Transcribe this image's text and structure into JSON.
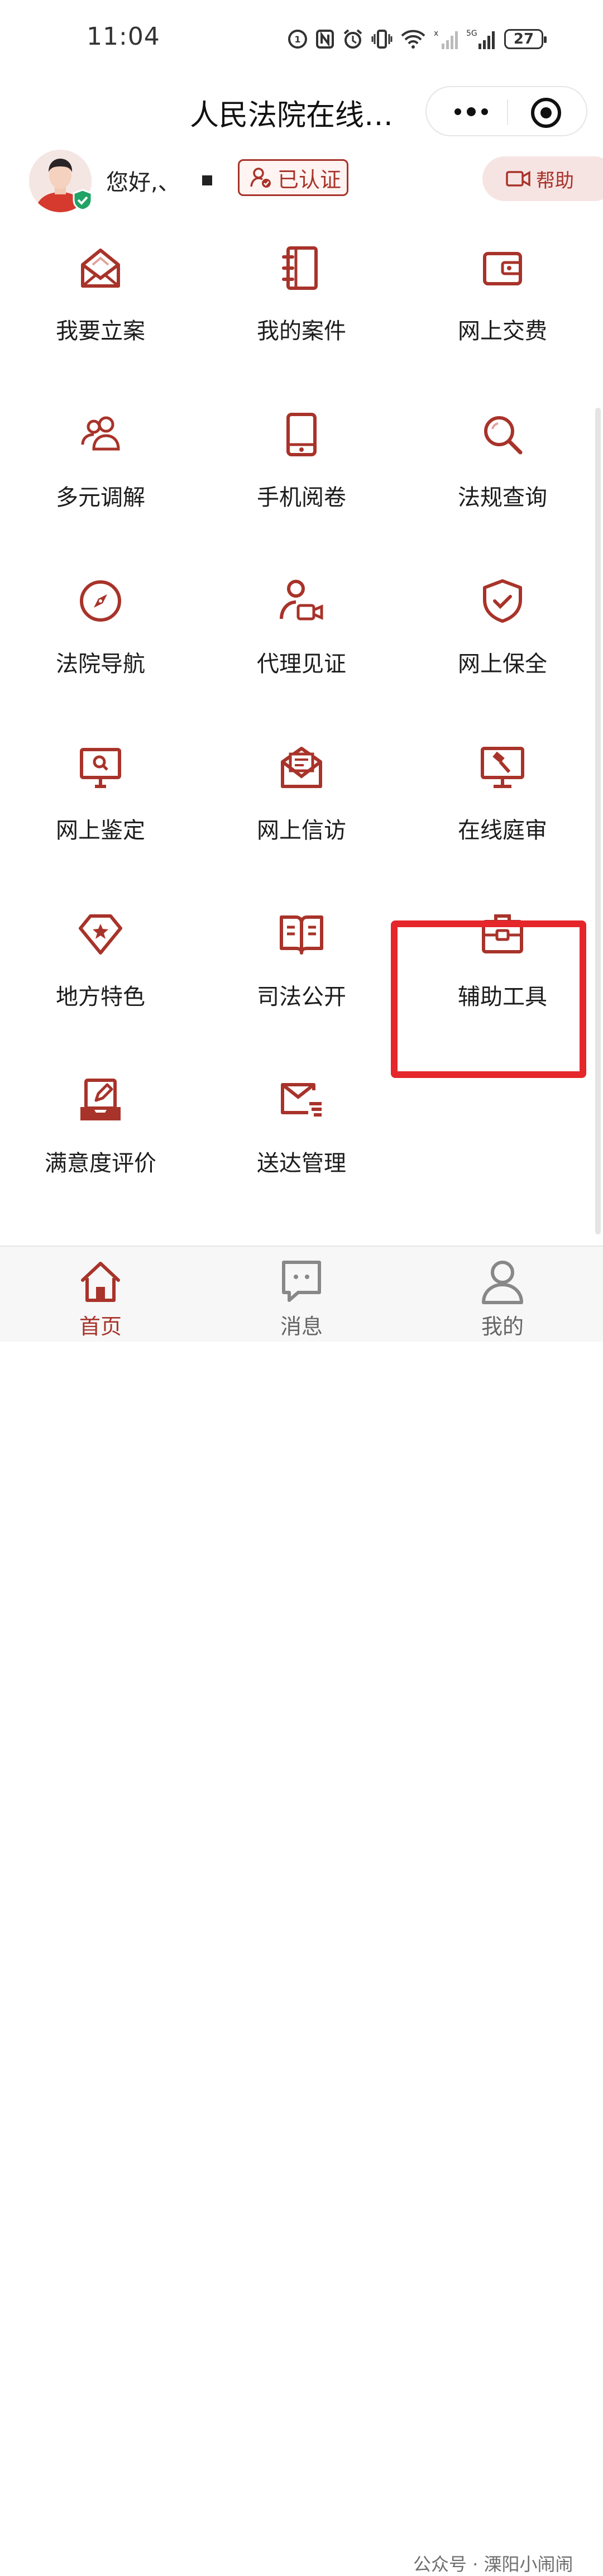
{
  "status_bar": {
    "time": "11:04",
    "battery": "27",
    "network_label": "5G"
  },
  "header": {
    "title": "人民法院在线…"
  },
  "user": {
    "greeting": "您好,、",
    "certified_label": "已认证",
    "help_label": "帮助"
  },
  "grid": {
    "items": [
      {
        "label": "我要立案",
        "icon": "envelope-open-icon"
      },
      {
        "label": "我的案件",
        "icon": "notebook-icon"
      },
      {
        "label": "网上交费",
        "icon": "wallet-icon"
      },
      {
        "label": "多元调解",
        "icon": "people-icon"
      },
      {
        "label": "手机阅卷",
        "icon": "phone-icon"
      },
      {
        "label": "法规查询",
        "icon": "search-icon"
      },
      {
        "label": "法院导航",
        "icon": "compass-icon"
      },
      {
        "label": "代理见证",
        "icon": "user-video-icon"
      },
      {
        "label": "网上保全",
        "icon": "shield-check-icon"
      },
      {
        "label": "网上鉴定",
        "icon": "monitor-search-icon"
      },
      {
        "label": "网上信访",
        "icon": "mail-letter-icon"
      },
      {
        "label": "在线庭审",
        "icon": "gavel-screen-icon"
      },
      {
        "label": "地方特色",
        "icon": "star-diamond-icon"
      },
      {
        "label": "司法公开",
        "icon": "open-book-icon"
      },
      {
        "label": "辅助工具",
        "icon": "toolbox-icon"
      },
      {
        "label": "满意度评价",
        "icon": "tray-edit-icon"
      },
      {
        "label": "送达管理",
        "icon": "mail-lines-icon"
      }
    ]
  },
  "tab_bar": {
    "tabs": [
      {
        "label": "首页",
        "active": true
      },
      {
        "label": "消息",
        "active": false
      },
      {
        "label": "我的",
        "active": false
      }
    ]
  },
  "watermark": "公众号 · 溧阳小闹闹",
  "colors": {
    "accent": "#a8332a",
    "highlight": "#e5262b"
  }
}
